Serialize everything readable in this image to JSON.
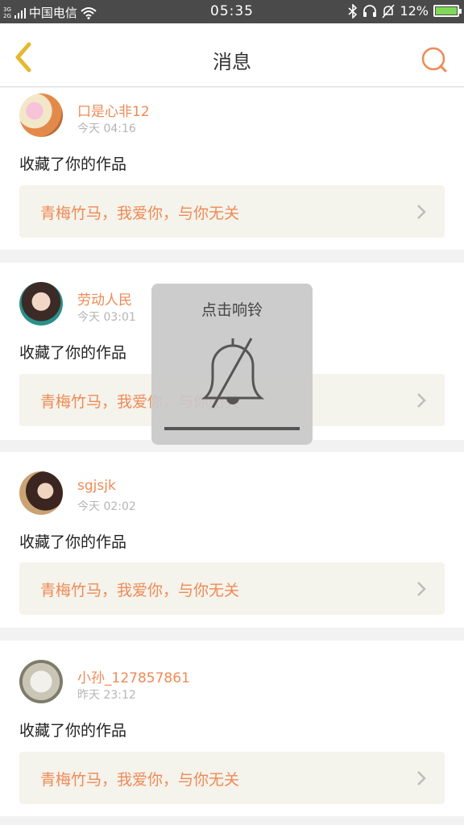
{
  "status_bar": {
    "network_top": "3G",
    "network_bottom": "2G",
    "carrier": "中国电信",
    "time": "05:35",
    "battery": "12%",
    "icons": [
      "wifi-icon",
      "bluetooth-icon",
      "headset-icon",
      "bell-off-icon",
      "battery-icon"
    ]
  },
  "header": {
    "title": "消息",
    "back_icon": "back-chevron-icon",
    "search_icon": "search-icon",
    "accent": "#ef8a55",
    "back_color": "#e6b830"
  },
  "messages": [
    {
      "user": "口是心非12",
      "time": "今天 04:16",
      "action": "收藏了你的作品",
      "work": "青梅竹马，我爱你，与你无关"
    },
    {
      "user": "劳动人民",
      "time": "今天 03:01",
      "action": "收藏了你的作品",
      "work": "青梅竹马，我爱你，与你无关"
    },
    {
      "user": "sgjsjk",
      "time": "今天 02:02",
      "action": "收藏了你的作品",
      "work": "青梅竹马，我爱你，与你无关"
    },
    {
      "user": "小孙_127857861",
      "time": "昨天 23:12",
      "action": "收藏了你的作品",
      "work": "青梅竹马，我爱你，与你无关"
    }
  ],
  "toast": {
    "label": "点击响铃",
    "icon": "bell-off-icon"
  }
}
